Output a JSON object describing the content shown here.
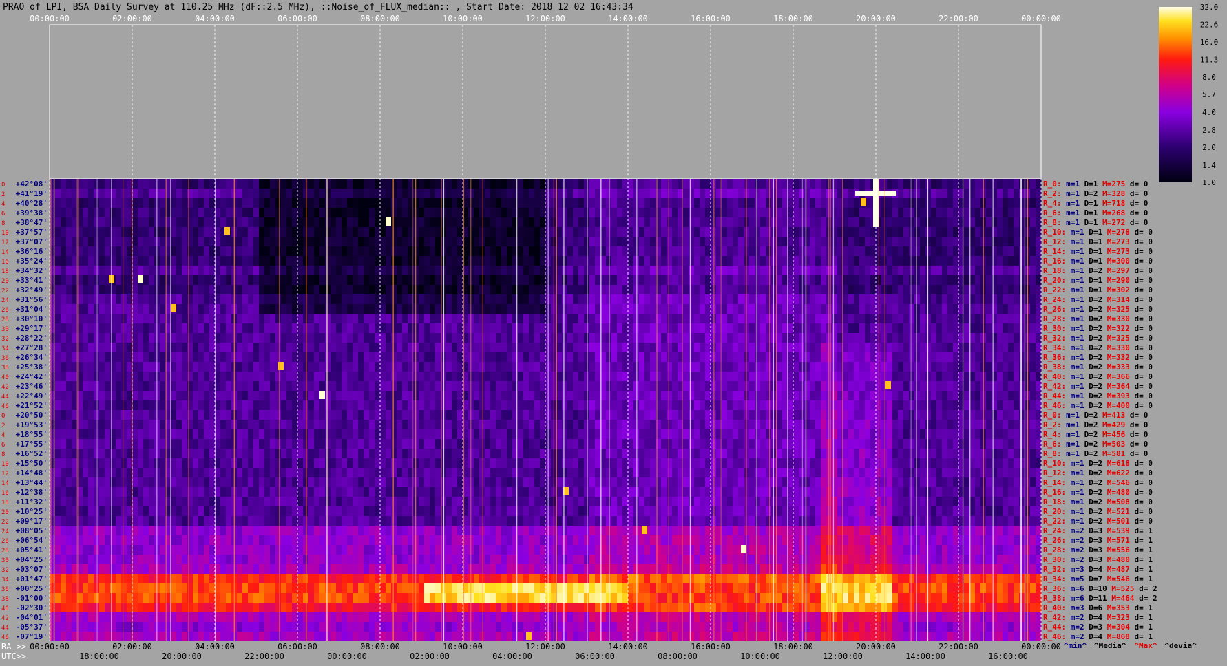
{
  "title": "PRAO of LPI, BSA Daily Survey at 110.25 MHz (dF::2.5 MHz), ::Noise_of_FLUX_median:: , Start Date: 2018 12 02 16:43:34",
  "colors": {
    "background": "#a4a4a4",
    "title_text": "#000000",
    "tick_text": "#ffffff",
    "red_text": "#e00000",
    "navy_text": "#000080"
  },
  "chart_data": {
    "type": "heatmap",
    "title": "PRAO of LPI, BSA Daily Survey at 110.25 MHz (dF::2.5 MHz), ::Noise_of_FLUX_median:: , Start Date: 2018 12 02 16:43:34",
    "colormap": "gnuplot-like (black-purple-red-yellow-white)",
    "colorbar": {
      "ticks": [
        "32.0",
        "22.6",
        "16.0",
        "11.3",
        "8.0",
        "5.7",
        "4.0",
        "2.8",
        "2.0",
        "1.4",
        "1.0"
      ],
      "range": [
        1.0,
        32.0
      ],
      "scale": "log"
    },
    "x_top_ticks": [
      "00:00:00",
      "02:00:00",
      "04:00:00",
      "06:00:00",
      "08:00:00",
      "10:00:00",
      "12:00:00",
      "14:00:00",
      "16:00:00",
      "18:00:00",
      "20:00:00",
      "22:00:00",
      "00:00:00"
    ],
    "x_bottom_ra_label": "RA >>",
    "x_bottom_ra_ticks": [
      "00:00:00",
      "02:00:00",
      "04:00:00",
      "06:00:00",
      "08:00:00",
      "10:00:00",
      "12:00:00",
      "14:00:00",
      "16:00:00",
      "18:00:00",
      "20:00:00",
      "22:00:00",
      "00:00:00"
    ],
    "x_bottom_utc_label": "UTC>>",
    "x_bottom_utc_ticks": [
      "18:00:00",
      "20:00:00",
      "22:00:00",
      "00:00:00",
      "02:00:00",
      "04:00:00",
      "06:00:00",
      "08:00:00",
      "10:00:00",
      "12:00:00",
      "14:00:00",
      "16:00:00"
    ],
    "declinations": [
      "+42°08'",
      "+41°19'",
      "+40°28'",
      "+39°38'",
      "+38°47'",
      "+37°57'",
      "+37°07'",
      "+36°16'",
      "+35°24'",
      "+34°32'",
      "+33°41'",
      "+32°49'",
      "+31°56'",
      "+31°04'",
      "+30°10'",
      "+29°17'",
      "+28°22'",
      "+27°28'",
      "+26°34'",
      "+25°38'",
      "+24°42'",
      "+23°46'",
      "+22°49'",
      "+21°52'",
      "+20°50'",
      "+19°53'",
      "+18°55'",
      "+17°55'",
      "+16°52'",
      "+15°50'",
      "+14°48'",
      "+13°44'",
      "+12°38'",
      "+11°32'",
      "+10°25'",
      "+09°17'",
      "+08°05'",
      "+06°54'",
      "+05°41'",
      "+04°25'",
      "+03°07'",
      "+01°47'",
      "+00°25'",
      "-01°00'",
      "-02°30'",
      "-04°01'",
      "-05°37'",
      "-07°19'"
    ],
    "row_stats": [
      {
        "r": "R_0:",
        "m": "m=1",
        "D": "D=1",
        "M": "M=275",
        "d": "d= 0"
      },
      {
        "r": "R_2:",
        "m": "m=1",
        "D": "D=2",
        "M": "M=328",
        "d": "d= 0"
      },
      {
        "r": "R_4:",
        "m": "m=1",
        "D": "D=1",
        "M": "M=718",
        "d": "d= 0"
      },
      {
        "r": "R_6:",
        "m": "m=1",
        "D": "D=1",
        "M": "M=268",
        "d": "d= 0"
      },
      {
        "r": "R_8:",
        "m": "m=1",
        "D": "D=1",
        "M": "M=272",
        "d": "d= 0"
      },
      {
        "r": "R_10:",
        "m": "m=1",
        "D": "D=1",
        "M": "M=278",
        "d": "d= 0"
      },
      {
        "r": "R_12:",
        "m": "m=1",
        "D": "D=1",
        "M": "M=273",
        "d": "d= 0"
      },
      {
        "r": "R_14:",
        "m": "m=1",
        "D": "D=1",
        "M": "M=273",
        "d": "d= 0"
      },
      {
        "r": "R_16:",
        "m": "m=1",
        "D": "D=1",
        "M": "M=300",
        "d": "d= 0"
      },
      {
        "r": "R_18:",
        "m": "m=1",
        "D": "D=2",
        "M": "M=297",
        "d": "d= 0"
      },
      {
        "r": "R_20:",
        "m": "m=1",
        "D": "D=1",
        "M": "M=290",
        "d": "d= 0"
      },
      {
        "r": "R_22:",
        "m": "m=1",
        "D": "D=1",
        "M": "M=302",
        "d": "d= 0"
      },
      {
        "r": "R_24:",
        "m": "m=1",
        "D": "D=2",
        "M": "M=314",
        "d": "d= 0"
      },
      {
        "r": "R_26:",
        "m": "m=1",
        "D": "D=2",
        "M": "M=325",
        "d": "d= 0"
      },
      {
        "r": "R_28:",
        "m": "m=1",
        "D": "D=2",
        "M": "M=330",
        "d": "d= 0"
      },
      {
        "r": "R_30:",
        "m": "m=1",
        "D": "D=2",
        "M": "M=322",
        "d": "d= 0"
      },
      {
        "r": "R_32:",
        "m": "m=1",
        "D": "D=2",
        "M": "M=325",
        "d": "d= 0"
      },
      {
        "r": "R_34:",
        "m": "m=1",
        "D": "D=2",
        "M": "M=330",
        "d": "d= 0"
      },
      {
        "r": "R_36:",
        "m": "m=1",
        "D": "D=2",
        "M": "M=332",
        "d": "d= 0"
      },
      {
        "r": "R_38:",
        "m": "m=1",
        "D": "D=2",
        "M": "M=333",
        "d": "d= 0"
      },
      {
        "r": "R_40:",
        "m": "m=1",
        "D": "D=2",
        "M": "M=366",
        "d": "d= 0"
      },
      {
        "r": "R_42:",
        "m": "m=1",
        "D": "D=2",
        "M": "M=364",
        "d": "d= 0"
      },
      {
        "r": "R_44:",
        "m": "m=1",
        "D": "D=2",
        "M": "M=393",
        "d": "d= 0"
      },
      {
        "r": "R_46:",
        "m": "m=1",
        "D": "D=2",
        "M": "M=400",
        "d": "d= 0"
      },
      {
        "r": "R_0:",
        "m": "m=1",
        "D": "D=2",
        "M": "M=413",
        "d": "d= 0"
      },
      {
        "r": "R_2:",
        "m": "m=1",
        "D": "D=2",
        "M": "M=429",
        "d": "d= 0"
      },
      {
        "r": "R_4:",
        "m": "m=1",
        "D": "D=2",
        "M": "M=456",
        "d": "d= 0"
      },
      {
        "r": "R_6:",
        "m": "m=1",
        "D": "D=2",
        "M": "M=503",
        "d": "d= 0"
      },
      {
        "r": "R_8:",
        "m": "m=1",
        "D": "D=2",
        "M": "M=581",
        "d": "d= 0"
      },
      {
        "r": "R_10:",
        "m": "m=1",
        "D": "D=2",
        "M": "M=618",
        "d": "d= 0"
      },
      {
        "r": "R_12:",
        "m": "m=1",
        "D": "D=2",
        "M": "M=622",
        "d": "d= 0"
      },
      {
        "r": "R_14:",
        "m": "m=1",
        "D": "D=2",
        "M": "M=546",
        "d": "d= 0"
      },
      {
        "r": "R_16:",
        "m": "m=1",
        "D": "D=2",
        "M": "M=480",
        "d": "d= 0"
      },
      {
        "r": "R_18:",
        "m": "m=1",
        "D": "D=2",
        "M": "M=508",
        "d": "d= 0"
      },
      {
        "r": "R_20:",
        "m": "m=1",
        "D": "D=2",
        "M": "M=521",
        "d": "d= 0"
      },
      {
        "r": "R_22:",
        "m": "m=1",
        "D": "D=2",
        "M": "M=501",
        "d": "d= 0"
      },
      {
        "r": "R_24:",
        "m": "m=2",
        "D": "D=3",
        "M": "M=539",
        "d": "d= 1"
      },
      {
        "r": "R_26:",
        "m": "m=2",
        "D": "D=3",
        "M": "M=571",
        "d": "d= 1"
      },
      {
        "r": "R_28:",
        "m": "m=2",
        "D": "D=3",
        "M": "M=556",
        "d": "d= 1"
      },
      {
        "r": "R_30:",
        "m": "m=2",
        "D": "D=3",
        "M": "M=480",
        "d": "d= 1"
      },
      {
        "r": "R_32:",
        "m": "m=3",
        "D": "D=4",
        "M": "M=487",
        "d": "d= 1"
      },
      {
        "r": "R_34:",
        "m": "m=5",
        "D": "D=7",
        "M": "M=546",
        "d": "d= 1"
      },
      {
        "r": "R_36:",
        "m": "m=6",
        "D": "D=10",
        "M": "M=525",
        "d": "d= 2"
      },
      {
        "r": "R_38:",
        "m": "m=6",
        "D": "D=11",
        "M": "M=464",
        "d": "d= 2"
      },
      {
        "r": "R_40:",
        "m": "m=3",
        "D": "D=6",
        "M": "M=353",
        "d": "d= 1"
      },
      {
        "r": "R_42:",
        "m": "m=2",
        "D": "D=4",
        "M": "M=323",
        "d": "d= 1"
      },
      {
        "r": "R_44:",
        "m": "m=2",
        "D": "D=3",
        "M": "M=304",
        "d": "d= 1"
      },
      {
        "r": "R_46:",
        "m": "m=2",
        "D": "D=4",
        "M": "M=868",
        "d": "d= 1"
      }
    ],
    "stats_legend": [
      "^min^",
      "^Media^",
      "^Max^",
      "^devia^"
    ],
    "row_index_labels": [
      "0",
      "2",
      "4",
      "6",
      "8",
      "10",
      "12",
      "14",
      "16",
      "18",
      "20",
      "22",
      "24",
      "26",
      "28",
      "30",
      "32",
      "34",
      "36",
      "38",
      "40",
      "42",
      "44",
      "46",
      "0",
      "2",
      "4",
      "6",
      "8",
      "10",
      "12",
      "14",
      "16",
      "18",
      "20",
      "22",
      "24",
      "26",
      "28",
      "30",
      "32",
      "34",
      "36",
      "38",
      "40",
      "42",
      "44",
      "46"
    ]
  }
}
